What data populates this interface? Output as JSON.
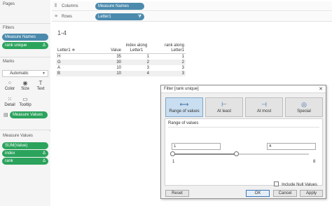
{
  "left_panel": {
    "pages_title": "Pages",
    "filters_title": "Filters",
    "filters": [
      {
        "label": "Measure Names",
        "delta": ""
      },
      {
        "label": "rank unique",
        "delta": "Δ"
      }
    ],
    "marks_title": "Marks",
    "marks_type": "Automatic",
    "marks_buttons": [
      {
        "label": "Color",
        "icon": "color-palette-icon",
        "glyph": "⁘"
      },
      {
        "label": "Size",
        "icon": "size-icon",
        "glyph": "◉"
      },
      {
        "label": "Text",
        "icon": "text-icon",
        "glyph": "T"
      },
      {
        "label": "Detail",
        "icon": "detail-icon",
        "glyph": "⁙"
      },
      {
        "label": "Tooltip",
        "icon": "tooltip-icon",
        "glyph": "▭"
      }
    ],
    "marks_pill": "Measure Values",
    "measure_values_title": "Measure Values",
    "measure_values": [
      {
        "label": "SUM(Value)",
        "delta": ""
      },
      {
        "label": "index",
        "delta": "Δ"
      },
      {
        "label": "rank",
        "delta": "Δ"
      }
    ]
  },
  "shelves": {
    "columns_label": "Columns",
    "columns_pill": "Measure Names",
    "rows_label": "Rows",
    "rows_pill": "Letter1",
    "rows_pill_icon": "⧩"
  },
  "sheet": {
    "title": "1-4",
    "headers": [
      "Letter1",
      "Value",
      "index along\nLetter1",
      "rank along Letter1"
    ],
    "sort_icon": "≑",
    "rows": [
      [
        "H",
        "35",
        "1",
        "1"
      ],
      [
        "G",
        "30",
        "2",
        "2"
      ],
      [
        "A",
        "10",
        "3",
        "3"
      ],
      [
        "B",
        "10",
        "4",
        "3"
      ]
    ]
  },
  "dialog": {
    "title": "Filter [rank unique]",
    "close": "✕",
    "tabs": [
      {
        "label": "Range of values",
        "active": true,
        "glyph": "⟷"
      },
      {
        "label": "At least",
        "active": false,
        "glyph": "⊢"
      },
      {
        "label": "At most",
        "active": false,
        "glyph": "⊣"
      },
      {
        "label": "Special",
        "active": false,
        "glyph": "◎"
      }
    ],
    "range_title": "Range of values",
    "min_value": "1",
    "max_value": "4",
    "min_tick": "1",
    "max_tick": "8",
    "include_null": "Include Null Values",
    "include_null_checked": false,
    "reset": "Reset",
    "ok": "OK",
    "cancel": "Cancel",
    "apply": "Apply"
  },
  "colors": {
    "pill_blue": "#4b8aad",
    "pill_green": "#2ba35c",
    "active_tab": "#c9def0"
  }
}
